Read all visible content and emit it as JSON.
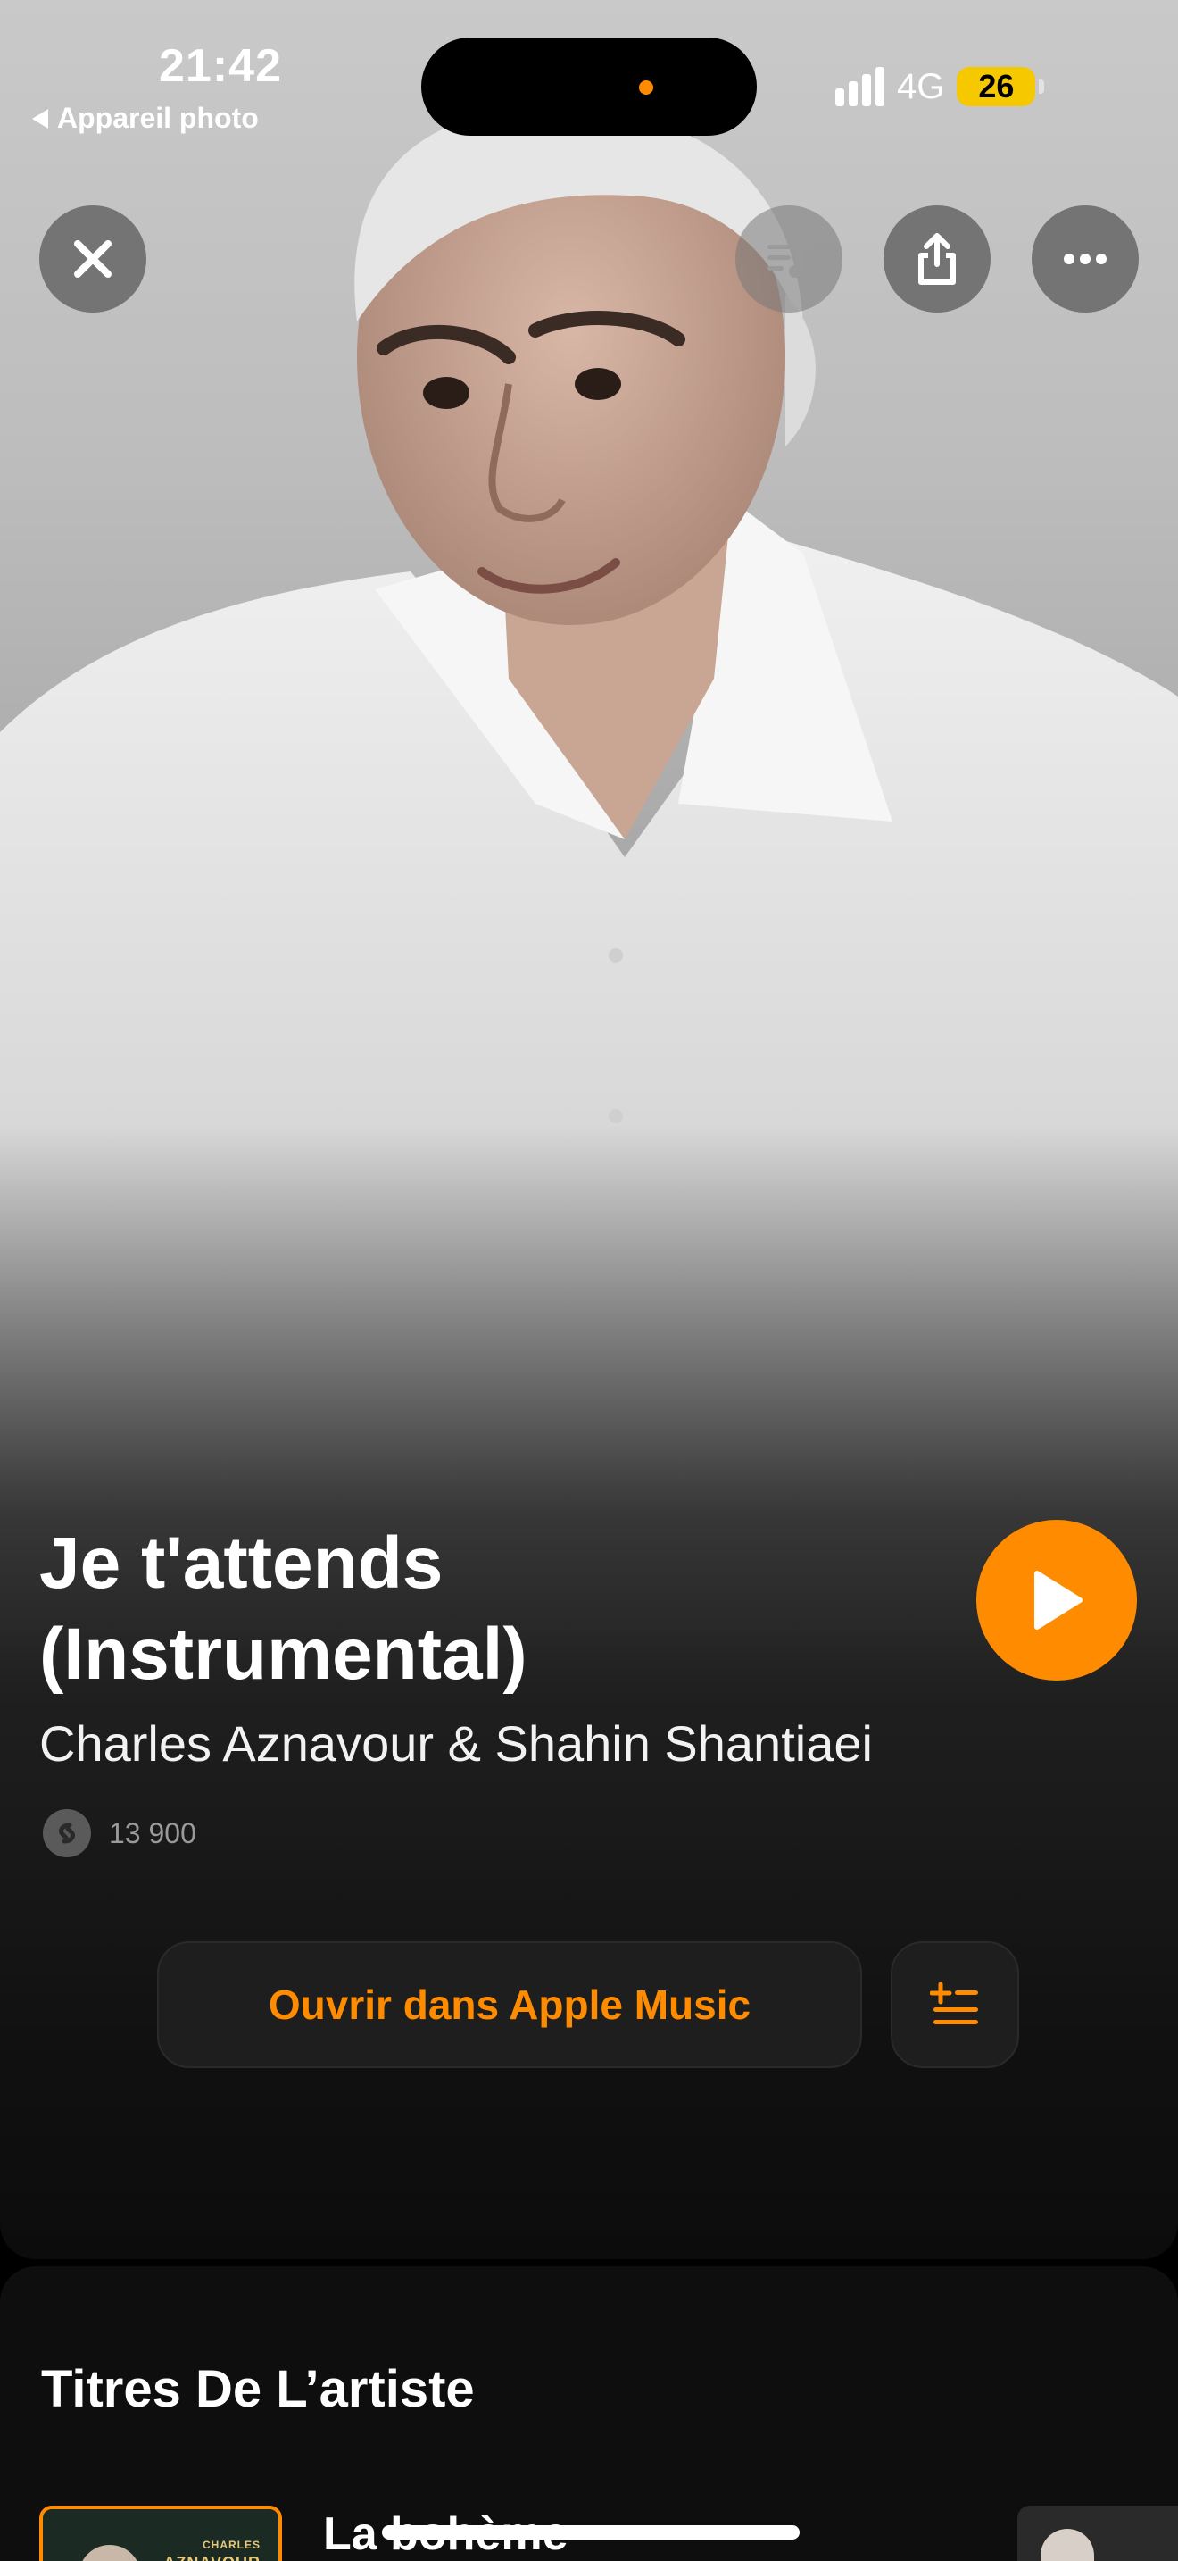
{
  "status_bar": {
    "time": "21:42",
    "back_app": "Appareil photo",
    "network": "4G",
    "battery": "26"
  },
  "top_controls": {
    "close_icon": "close-icon",
    "queue_icon": "music-queue-icon",
    "share_icon": "share-icon",
    "more_icon": "more-icon"
  },
  "song": {
    "title_line1": "Je t'attends",
    "title_line2": "(Instrumental)",
    "artist": "Charles Aznavour & Shahin Shantiaei",
    "shazam_count": "13 900"
  },
  "actions": {
    "open_apple_music": "Ouvrir dans Apple Music",
    "add_to_queue_icon": "add-to-queue-icon",
    "play_icon": "play-icon"
  },
  "artist_tracks": {
    "section_title": "Titres De L’artiste",
    "tracks": [
      {
        "title": "La bohème",
        "cover_text_top": "CHARLES",
        "cover_text_bottom": "AZNAVOUR"
      }
    ]
  },
  "colors": {
    "accent": "#ff8c00",
    "battery": "#f5c800",
    "surface": "#1e1e1e"
  }
}
